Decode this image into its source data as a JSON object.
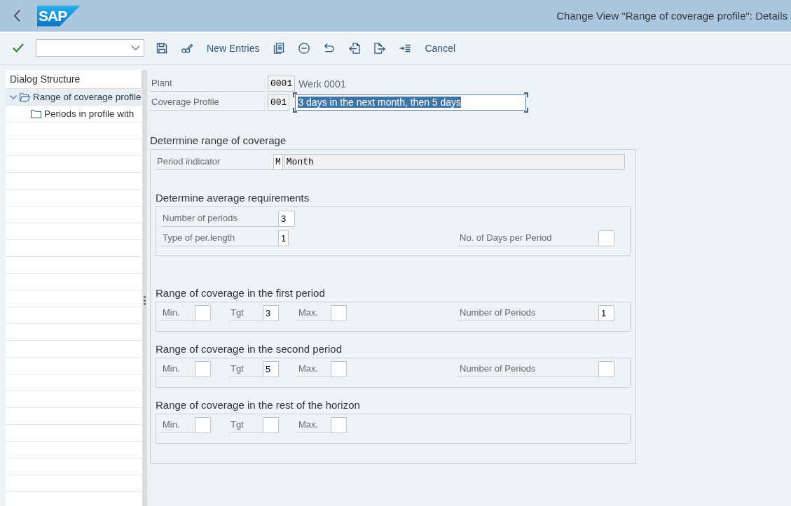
{
  "header": {
    "logo": "SAP",
    "title": "Change View \"Range of coverage profile\": Details"
  },
  "toolbar": {
    "new_entries": "New Entries",
    "cancel": "Cancel"
  },
  "dialog_structure": {
    "title": "Dialog Structure",
    "items": [
      {
        "label": "Range of coverage profile",
        "selected": true,
        "expanded": true,
        "children": [
          {
            "label": "Periods in profile with",
            "selected": false
          }
        ]
      }
    ]
  },
  "header_fields": [
    {
      "label": "Plant",
      "value": "0001",
      "kind": "display",
      "description": "Werk 0001"
    },
    {
      "label": "Coverage Profile",
      "value": "001",
      "kind": "input",
      "description": "3 days in the next month, then 5 days",
      "focused": true
    }
  ],
  "coverage": {
    "title": "Determine range of coverage",
    "period_indicator": {
      "label": "Period indicator",
      "code": "M",
      "text": "Month"
    },
    "groups": [
      {
        "title": "Determine average requirements",
        "kind": "average",
        "rows": [
          {
            "left": [
              {
                "label": "Number of periods",
                "value": "3"
              }
            ]
          },
          {
            "left": [
              {
                "label": "Type of per.length",
                "value": "1"
              }
            ],
            "right": [
              {
                "label": "No. of Days per Period"
              }
            ]
          }
        ]
      },
      {
        "title": "Range of coverage in the first period",
        "kind": "range",
        "rows": [
          {
            "left": [
              {
                "label": "Min."
              },
              {
                "label": "Tgt",
                "value": "3"
              },
              {
                "label": "Max."
              }
            ],
            "right": [
              {
                "label": "Number of Periods",
                "value": "1"
              }
            ]
          }
        ]
      },
      {
        "title": "Range of coverage in the second period",
        "kind": "range",
        "rows": [
          {
            "left": [
              {
                "label": "Min."
              },
              {
                "label": "Tgt",
                "value": "5"
              },
              {
                "label": "Max."
              }
            ],
            "right": [
              {
                "label": "Number of Periods"
              }
            ]
          }
        ]
      },
      {
        "title": "Range of coverage in the rest of the horizon",
        "kind": "range",
        "rows": [
          {
            "left": [
              {
                "label": "Min."
              },
              {
                "label": "Tgt"
              },
              {
                "label": "Max."
              }
            ]
          }
        ]
      }
    ]
  }
}
